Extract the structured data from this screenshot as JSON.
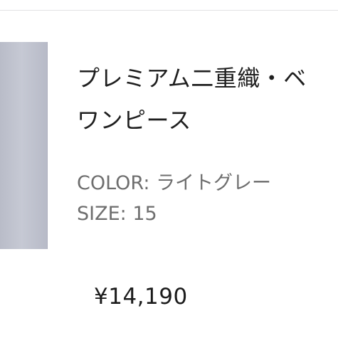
{
  "product": {
    "name": "プレミアム二重織・ベ\nワンピース",
    "color_label": "COLOR:",
    "color_value": "ライトグレー",
    "size_label": "SIZE:",
    "size_value": "15",
    "price": "¥14,190",
    "thumbnail_color": "#c2c5d0"
  }
}
